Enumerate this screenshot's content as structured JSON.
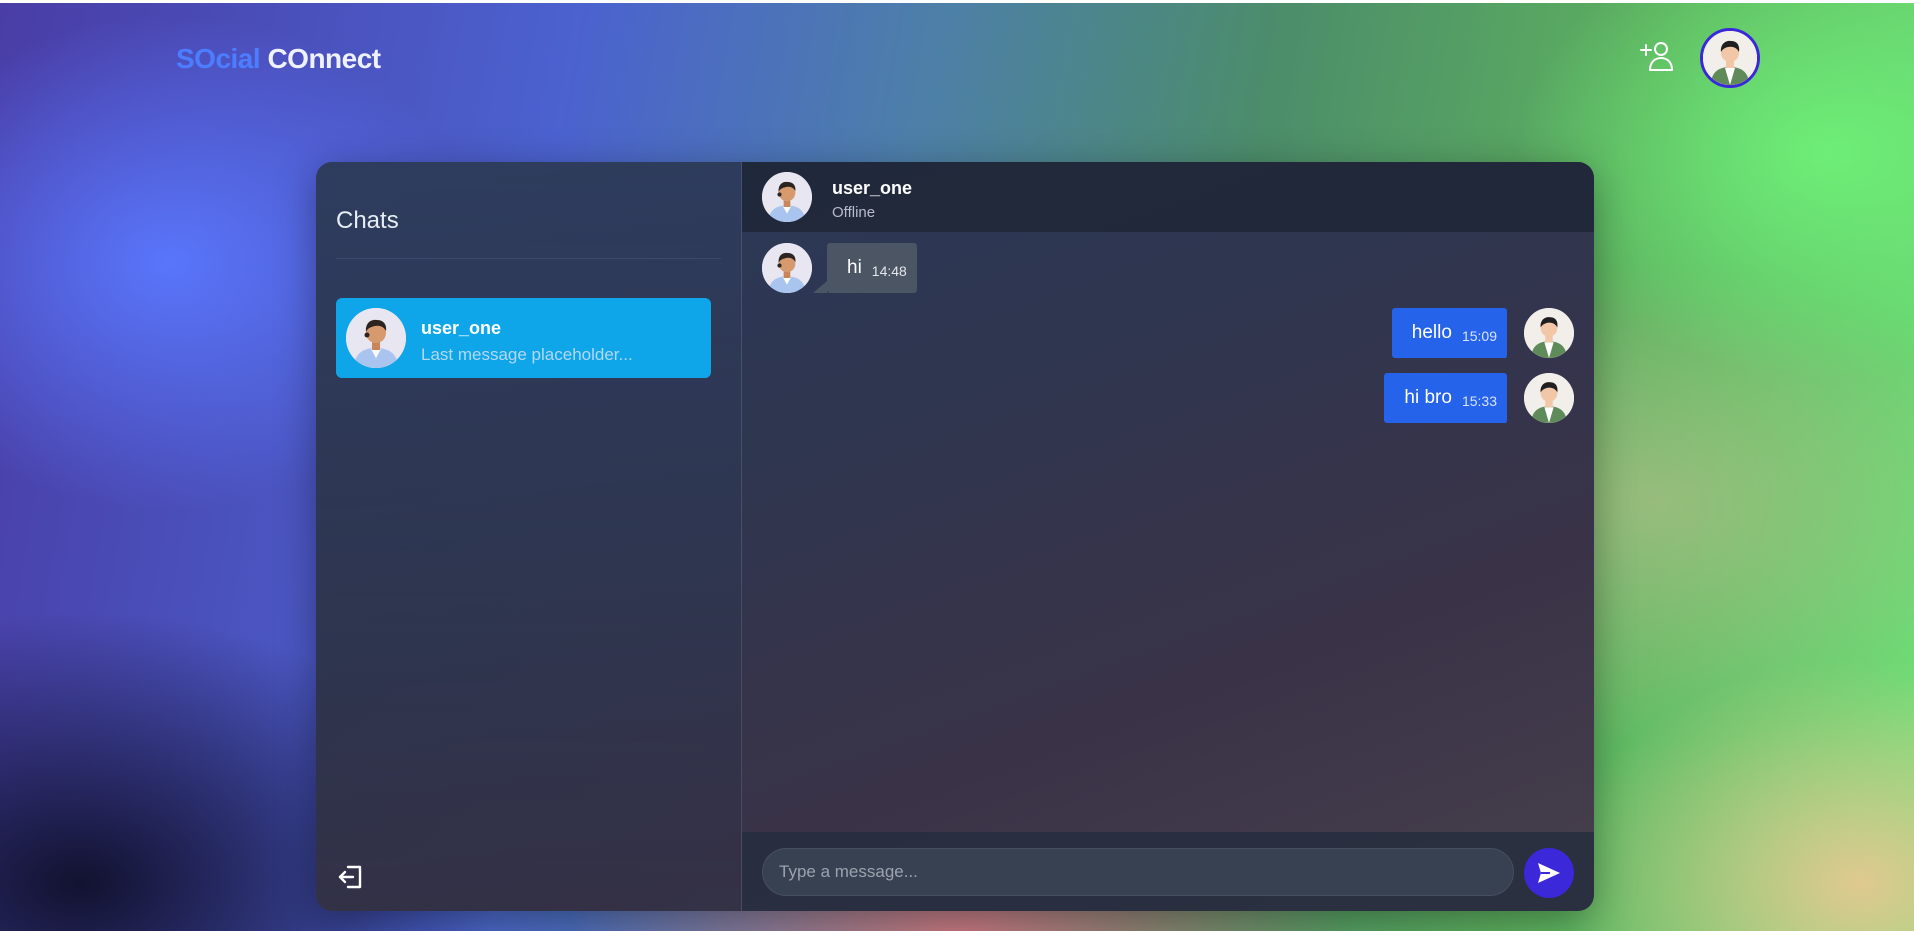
{
  "app": {
    "brand_part1": "SOcial",
    "brand_part2": "COnnect"
  },
  "header": {
    "add_user_icon": "user-plus-icon",
    "profile_avatar_icon": "user-avatar"
  },
  "sidebar": {
    "title": "Chats",
    "chats": [
      {
        "name": "user_one",
        "last_message": "Last message placeholder...",
        "active": true
      }
    ],
    "logout_icon": "logout-icon"
  },
  "chat": {
    "header": {
      "name": "user_one",
      "status": "Offline"
    },
    "messages": [
      {
        "direction": "in",
        "text": "hi",
        "time": "14:48"
      },
      {
        "direction": "out",
        "text": "hello",
        "time": "15:09"
      },
      {
        "direction": "out",
        "text": "hi bro",
        "time": "15:33"
      }
    ],
    "composer": {
      "placeholder": "Type a message...",
      "value": ""
    },
    "send_icon": "send-icon"
  },
  "colors": {
    "accent": "#3b28d9",
    "active_chat": "#0ea5e9",
    "outgoing_bubble": "#2563eb",
    "incoming_bubble": "#4b5563",
    "brand_blue": "#4d7dff"
  }
}
